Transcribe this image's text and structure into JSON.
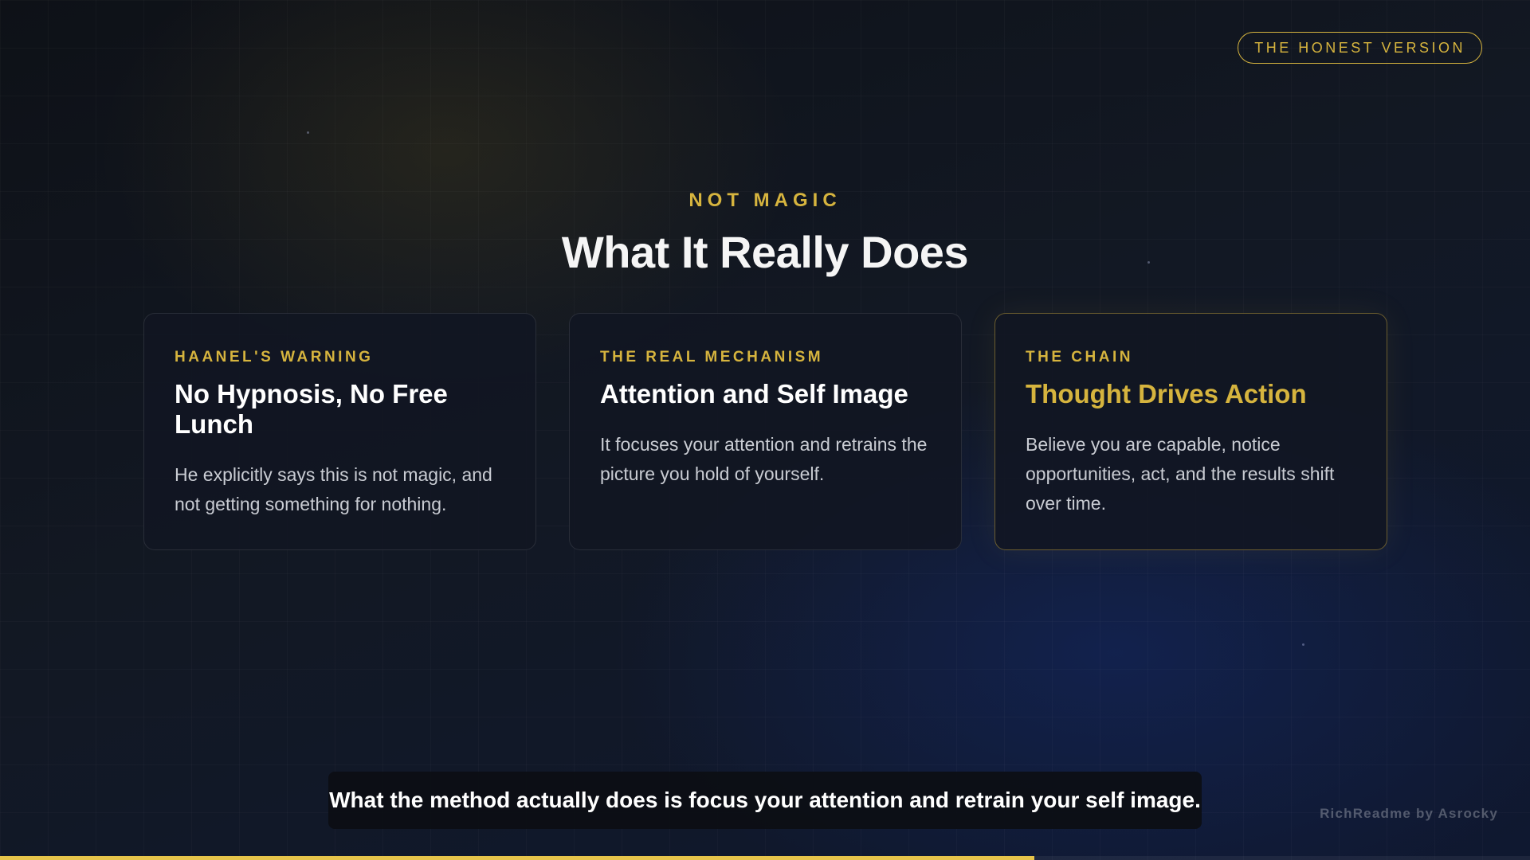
{
  "header": {
    "badge": "THE HONEST VERSION"
  },
  "hero": {
    "eyebrow": "NOT MAGIC",
    "title": "What It Really Does"
  },
  "cards": [
    {
      "label": "HAANEL'S WARNING",
      "title": "No Hypnosis, No Free Lunch",
      "body": "He explicitly says this is not magic, and not getting something for nothing."
    },
    {
      "label": "THE REAL MECHANISM",
      "title": "Attention and Self Image",
      "body": "It focuses your attention and retrains the picture you hold of yourself."
    },
    {
      "label": "THE CHAIN",
      "title": "Thought Drives Action",
      "body": "Believe you are capable, notice opportunities, act, and the results shift over time."
    }
  ],
  "caption": "What the method actually does is focus your attention and retrain your self image.",
  "credit": "RichReadme by Asrocky",
  "progress": {
    "fraction": 0.676
  },
  "colors": {
    "accent": "#d6b43e",
    "progress": "#e6c44a",
    "background": "#121823"
  }
}
